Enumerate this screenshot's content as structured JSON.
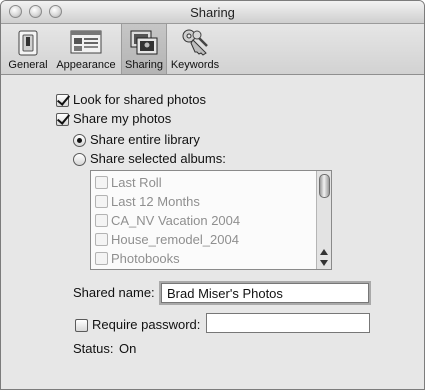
{
  "window": {
    "title": "Sharing"
  },
  "toolbar": {
    "items": [
      {
        "label": "General",
        "icon": "general-switch-icon"
      },
      {
        "label": "Appearance",
        "icon": "appearance-icon"
      },
      {
        "label": "Sharing",
        "icon": "sharing-icon",
        "selected": true
      },
      {
        "label": "Keywords",
        "icon": "keys-icon"
      }
    ]
  },
  "sharing": {
    "look_for_shared": {
      "label": "Look for shared photos",
      "checked": true
    },
    "share_my_photos": {
      "label": "Share my photos",
      "checked": true
    },
    "share_entire_library": {
      "label": "Share entire library",
      "selected": true
    },
    "share_selected_albums": {
      "label": "Share selected albums:",
      "selected": false
    },
    "albums": [
      {
        "label": "Last Roll",
        "checked": false
      },
      {
        "label": "Last 12 Months",
        "checked": false
      },
      {
        "label": "CA_NV Vacation 2004",
        "checked": false
      },
      {
        "label": "House_remodel_2004",
        "checked": false
      },
      {
        "label": "Photobooks",
        "checked": false
      }
    ],
    "shared_name": {
      "label": "Shared name:",
      "value": "Brad Miser's Photos"
    },
    "require_password": {
      "label": "Require password:",
      "checked": false,
      "value": ""
    },
    "status": {
      "label": "Status:",
      "value": "On"
    }
  }
}
